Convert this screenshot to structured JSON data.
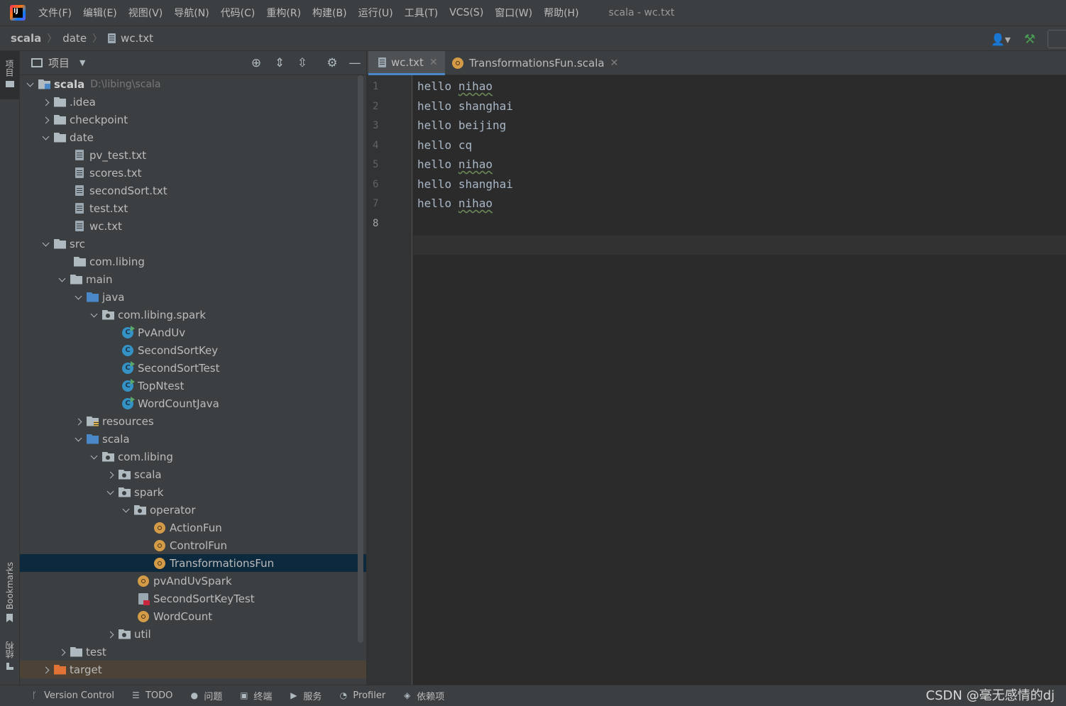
{
  "menubar": {
    "items": [
      "文件(F)",
      "编辑(E)",
      "视图(V)",
      "导航(N)",
      "代码(C)",
      "重构(R)",
      "构建(B)",
      "运行(U)",
      "工具(T)",
      "VCS(S)",
      "窗口(W)",
      "帮助(H)"
    ],
    "window_title": "scala - wc.txt"
  },
  "breadcrumb": {
    "items": [
      "scala",
      "date",
      "wc.txt"
    ]
  },
  "left_strip": {
    "project": "项目",
    "bookmarks": "Bookmarks",
    "structure": "结构"
  },
  "project_panel": {
    "title": "项目",
    "tree": [
      {
        "label": "scala",
        "path": "D:\\libing\\scala",
        "bold": true
      },
      {
        "label": ".idea"
      },
      {
        "label": "checkpoint"
      },
      {
        "label": "date"
      },
      {
        "label": "pv_test.txt"
      },
      {
        "label": "scores.txt"
      },
      {
        "label": "secondSort.txt"
      },
      {
        "label": "test.txt"
      },
      {
        "label": "wc.txt"
      },
      {
        "label": "src"
      },
      {
        "label": "com.libing"
      },
      {
        "label": "main"
      },
      {
        "label": "java"
      },
      {
        "label": "com.libing.spark"
      },
      {
        "label": "PvAndUv"
      },
      {
        "label": "SecondSortKey"
      },
      {
        "label": "SecondSortTest"
      },
      {
        "label": "TopNtest"
      },
      {
        "label": "WordCountJava"
      },
      {
        "label": "resources"
      },
      {
        "label": "scala"
      },
      {
        "label": "com.libing"
      },
      {
        "label": "scala"
      },
      {
        "label": "spark"
      },
      {
        "label": "operator"
      },
      {
        "label": "ActionFun"
      },
      {
        "label": "ControlFun"
      },
      {
        "label": "TransformationsFun"
      },
      {
        "label": "pvAndUvSpark"
      },
      {
        "label": "SecondSortKeyTest"
      },
      {
        "label": "WordCount"
      },
      {
        "label": "util"
      },
      {
        "label": "test"
      },
      {
        "label": "target"
      }
    ]
  },
  "editor": {
    "tabs": [
      {
        "label": "wc.txt",
        "active": true
      },
      {
        "label": "TransformationsFun.scala",
        "active": false
      }
    ],
    "lines": [
      {
        "n": "1",
        "a": "hello",
        "b": "nihao",
        "typo": true
      },
      {
        "n": "2",
        "a": "hello",
        "b": "shanghai",
        "typo": false
      },
      {
        "n": "3",
        "a": "hello",
        "b": "beijing",
        "typo": false
      },
      {
        "n": "4",
        "a": "hello",
        "b": "cq",
        "typo": false
      },
      {
        "n": "5",
        "a": "hello",
        "b": "nihao",
        "typo": true
      },
      {
        "n": "6",
        "a": "hello",
        "b": "shanghai",
        "typo": false
      },
      {
        "n": "7",
        "a": "hello",
        "b": "nihao",
        "typo": true
      },
      {
        "n": "8",
        "a": "",
        "b": "",
        "typo": false
      }
    ],
    "current_line": "8"
  },
  "statusbar": {
    "items": [
      {
        "label": "Version Control",
        "icon": "branch-icon"
      },
      {
        "label": "TODO",
        "icon": "list-icon"
      },
      {
        "label": "问题",
        "icon": "problems-icon"
      },
      {
        "label": "终端",
        "icon": "terminal-icon"
      },
      {
        "label": "服务",
        "icon": "services-icon"
      },
      {
        "label": "Profiler",
        "icon": "profiler-icon"
      },
      {
        "label": "依赖项",
        "icon": "dependencies-icon"
      }
    ],
    "watermark": "CSDN @毫无感情的dj"
  }
}
